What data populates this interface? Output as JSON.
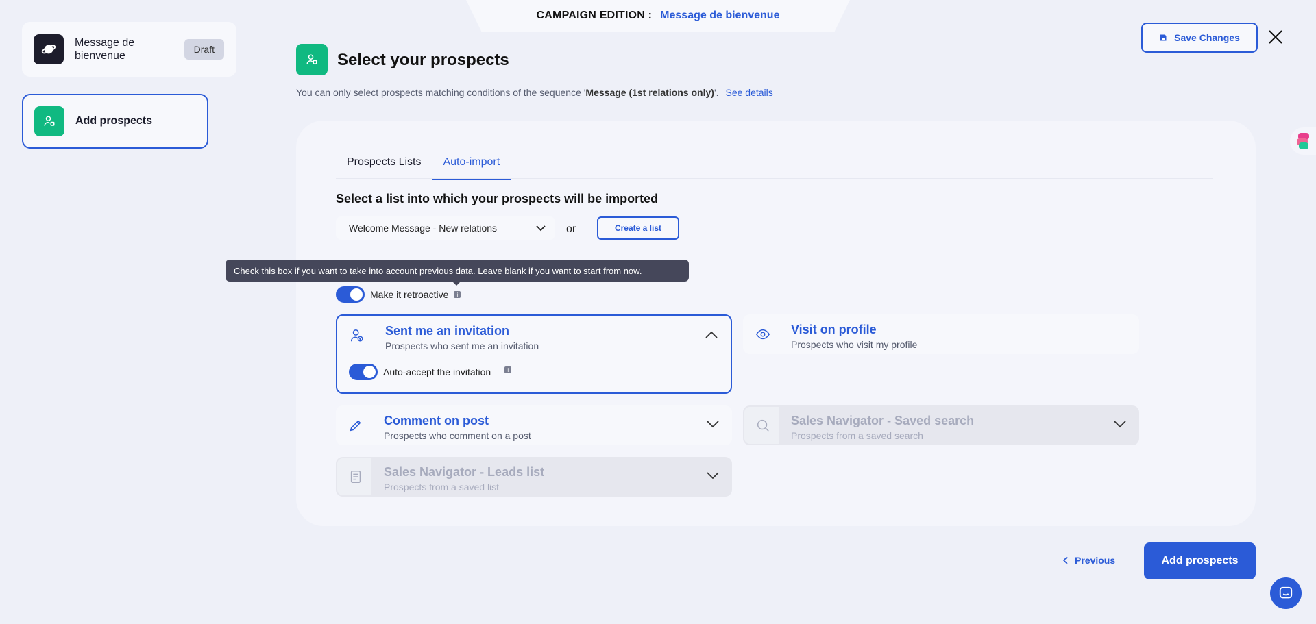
{
  "header": {
    "edition_label": "CAMPAIGN EDITION :",
    "campaign_name": "Message de bienvenue"
  },
  "sidebar": {
    "campaign_title": "Message de bienvenue",
    "status_badge": "Draft",
    "step_label": "Add prospects"
  },
  "page": {
    "title": "Select your prospects",
    "subtitle_prefix": "You can only select prospects matching conditions of the sequence '",
    "subtitle_sequence": "Message (1st relations only)",
    "subtitle_suffix": "'.",
    "see_details": "See details",
    "save_label": "Save Changes"
  },
  "tabs": [
    {
      "label": "Prospects Lists",
      "active": false
    },
    {
      "label": "Auto-import",
      "active": true
    }
  ],
  "import": {
    "select_title": "Select a list into which your prospects will be imported",
    "selected_list": "Welcome Message - New relations",
    "or_text": "or",
    "create_list": "Create a list",
    "tooltip": "Check this box if you want to take into account previous data. Leave blank if you want to start from now.",
    "retroactive_label": "Make it retroactive",
    "retroactive_on": true
  },
  "options": {
    "invitation": {
      "title": "Sent me an invitation",
      "sub": "Prospects who sent me an invitation",
      "auto_accept": "Auto-accept the invitation"
    },
    "visit": {
      "title": "Visit on profile",
      "sub": "Prospects who visit my profile"
    },
    "comment": {
      "title": "Comment on post",
      "sub": "Prospects who comment on a post"
    },
    "saved_search": {
      "title": "Sales Navigator - Saved search",
      "sub": "Prospects from a saved search"
    },
    "leads_list": {
      "title": "Sales Navigator - Leads list",
      "sub": "Prospects from a saved list"
    }
  },
  "footer": {
    "previous": "Previous",
    "add_prospects": "Add prospects"
  },
  "colors": {
    "accent": "#2b5bd7",
    "green": "#10b981",
    "background": "#eef0f8"
  }
}
